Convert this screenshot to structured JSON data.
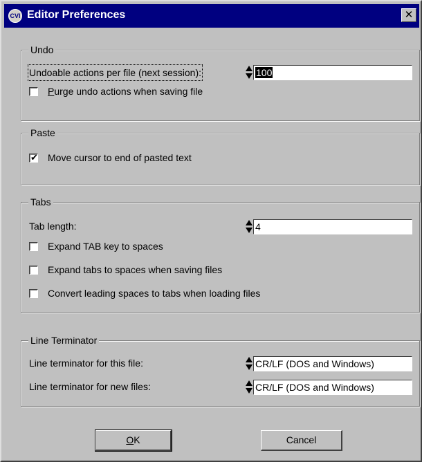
{
  "window": {
    "title": "Editor Preferences",
    "icon_label": "CVI",
    "close_label": "✕"
  },
  "undo": {
    "legend": "Undo",
    "actions_label": "Undoable actions per file (next session):",
    "actions_value": "100",
    "purge_label_u": "P",
    "purge_label_rest": "urge undo actions when saving file",
    "purge_checked": false
  },
  "paste": {
    "legend": "Paste",
    "move_cursor_label": "Move cursor to end of pasted text",
    "move_cursor_checked": true
  },
  "tabs": {
    "legend": "Tabs",
    "tab_length_label": "Tab length:",
    "tab_length_value": "4",
    "expand_tab_label": "Expand TAB key to spaces",
    "expand_tab_checked": false,
    "expand_saving_label": "Expand tabs to spaces when saving files",
    "expand_saving_checked": false,
    "convert_label": "Convert leading spaces to tabs when loading files",
    "convert_checked": false
  },
  "line_terminator": {
    "legend": "Line Terminator",
    "this_file_label": "Line terminator for this file:",
    "this_file_value": "CR/LF (DOS and Windows)",
    "new_files_label": "Line terminator for new files:",
    "new_files_value": "CR/LF (DOS and Windows)"
  },
  "buttons": {
    "ok_u": "O",
    "ok_rest": "K",
    "cancel_label": "Cancel"
  }
}
